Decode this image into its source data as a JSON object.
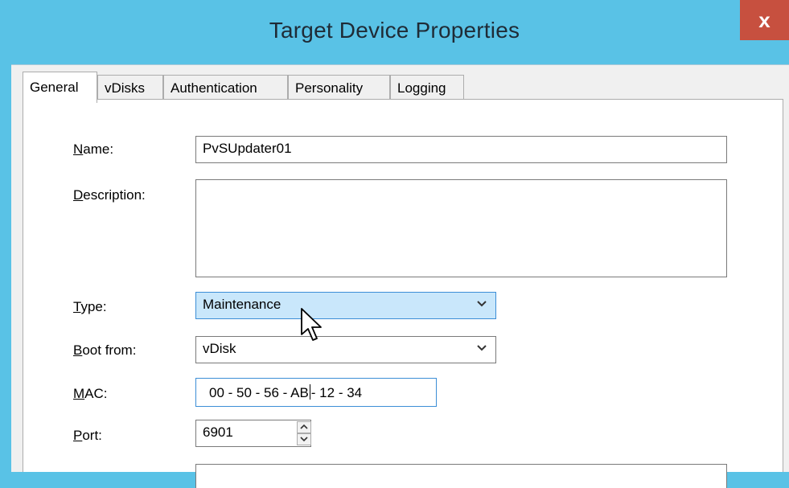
{
  "window": {
    "title": "Target Device Properties",
    "close_label": "x"
  },
  "tabs": [
    {
      "label": "General",
      "active": true
    },
    {
      "label": "vDisks",
      "active": false
    },
    {
      "label": "Authentication",
      "active": false
    },
    {
      "label": "Personality",
      "active": false
    },
    {
      "label": "Logging",
      "active": false
    }
  ],
  "form": {
    "name": {
      "mnemonic": "N",
      "label_rest": "ame:",
      "value": "PvSUpdater01"
    },
    "description": {
      "mnemonic": "D",
      "label_rest": "escription:",
      "value": ""
    },
    "type": {
      "mnemonic": "T",
      "label_rest": "ype:",
      "value": "Maintenance"
    },
    "boot_from": {
      "mnemonic": "B",
      "label_rest": "oot from:",
      "value": "vDisk"
    },
    "mac": {
      "mnemonic": "M",
      "label_rest": "AC:",
      "value_before_caret": "00 - 50 - 56 - AB",
      "value_after_caret": "- 12 - 34"
    },
    "port": {
      "mnemonic": "P",
      "label_rest": "ort:",
      "value": "6901"
    }
  },
  "colors": {
    "titlebar": "#59c2e6",
    "close": "#c7503f",
    "highlight": "#c9e7fb",
    "focus": "#3c8ed6"
  },
  "icons": {
    "close": "close-icon",
    "dropdown": "chevron-down-icon",
    "spin_up": "spin-up-icon",
    "spin_down": "spin-down-icon",
    "cursor": "mouse-pointer-icon"
  }
}
